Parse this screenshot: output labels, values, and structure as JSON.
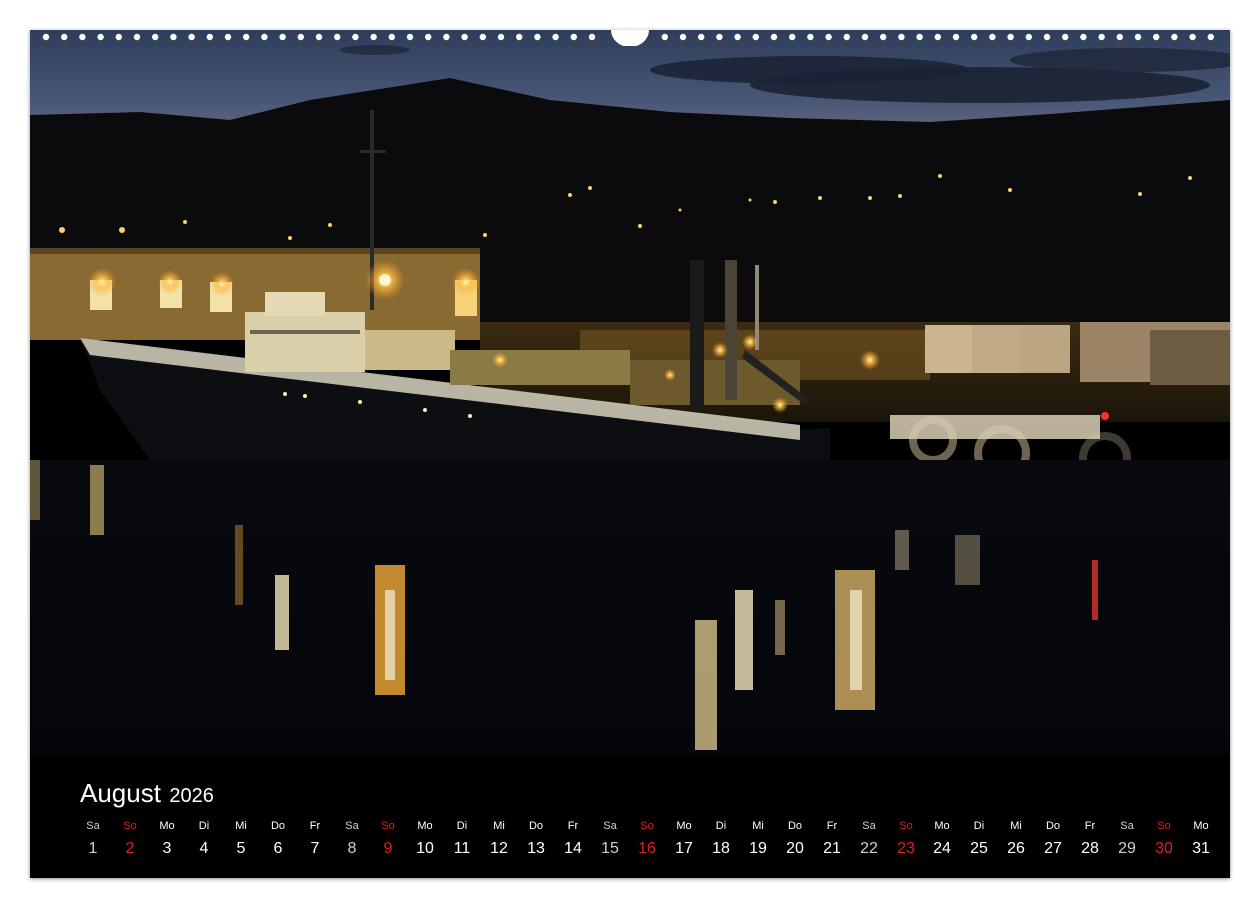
{
  "calendar": {
    "month": "August",
    "year": "2026",
    "accent_sunday": "#e0201a",
    "days": [
      {
        "wd": "Sa",
        "n": "1",
        "type": "sat"
      },
      {
        "wd": "So",
        "n": "2",
        "type": "sun"
      },
      {
        "wd": "Mo",
        "n": "3",
        "type": "wk"
      },
      {
        "wd": "Di",
        "n": "4",
        "type": "wk"
      },
      {
        "wd": "Mi",
        "n": "5",
        "type": "wk"
      },
      {
        "wd": "Do",
        "n": "6",
        "type": "wk"
      },
      {
        "wd": "Fr",
        "n": "7",
        "type": "wk"
      },
      {
        "wd": "Sa",
        "n": "8",
        "type": "sat"
      },
      {
        "wd": "So",
        "n": "9",
        "type": "sun"
      },
      {
        "wd": "Mo",
        "n": "10",
        "type": "wk"
      },
      {
        "wd": "Di",
        "n": "11",
        "type": "wk"
      },
      {
        "wd": "Mi",
        "n": "12",
        "type": "wk"
      },
      {
        "wd": "Do",
        "n": "13",
        "type": "wk"
      },
      {
        "wd": "Fr",
        "n": "14",
        "type": "wk"
      },
      {
        "wd": "Sa",
        "n": "15",
        "type": "sat"
      },
      {
        "wd": "So",
        "n": "16",
        "type": "sun"
      },
      {
        "wd": "Mo",
        "n": "17",
        "type": "wk"
      },
      {
        "wd": "Di",
        "n": "18",
        "type": "wk"
      },
      {
        "wd": "Mi",
        "n": "19",
        "type": "wk"
      },
      {
        "wd": "Do",
        "n": "20",
        "type": "wk"
      },
      {
        "wd": "Fr",
        "n": "21",
        "type": "wk"
      },
      {
        "wd": "Sa",
        "n": "22",
        "type": "sat"
      },
      {
        "wd": "So",
        "n": "23",
        "type": "sun"
      },
      {
        "wd": "Mo",
        "n": "24",
        "type": "wk"
      },
      {
        "wd": "Di",
        "n": "25",
        "type": "wk"
      },
      {
        "wd": "Mi",
        "n": "26",
        "type": "wk"
      },
      {
        "wd": "Do",
        "n": "27",
        "type": "wk"
      },
      {
        "wd": "Fr",
        "n": "28",
        "type": "wk"
      },
      {
        "wd": "Sa",
        "n": "29",
        "type": "sat"
      },
      {
        "wd": "So",
        "n": "30",
        "type": "sun"
      },
      {
        "wd": "Mo",
        "n": "31",
        "type": "wk"
      }
    ]
  },
  "photo": {
    "icon": "harbor-night-photo"
  }
}
